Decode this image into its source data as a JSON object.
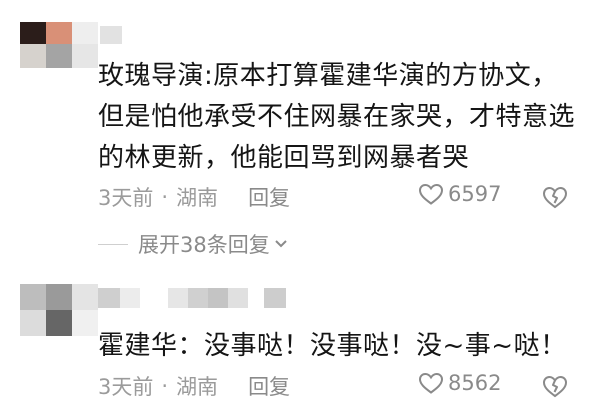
{
  "comments": [
    {
      "text": "玫瑰导演:原本打算霍建华演的方协文，但是怕他承受不住网暴在家哭，才特意选的林更新，他能回骂到网暴者哭",
      "time": "3天前",
      "separator": "·",
      "location": "湖南",
      "reply_label": "回复",
      "likes": "6597",
      "expand_label": "展开38条回复"
    },
    {
      "text": "霍建华：没事哒！没事哒！没~事~哒！",
      "time": "3天前",
      "separator": "·",
      "location": "湖南",
      "reply_label": "回复",
      "likes": "8562"
    }
  ],
  "icons": {
    "like": "heart-icon",
    "dislike": "broken-heart-icon",
    "expand": "chevron-down-icon"
  },
  "colors": {
    "text": "#151515",
    "meta": "#9b9b9b"
  }
}
